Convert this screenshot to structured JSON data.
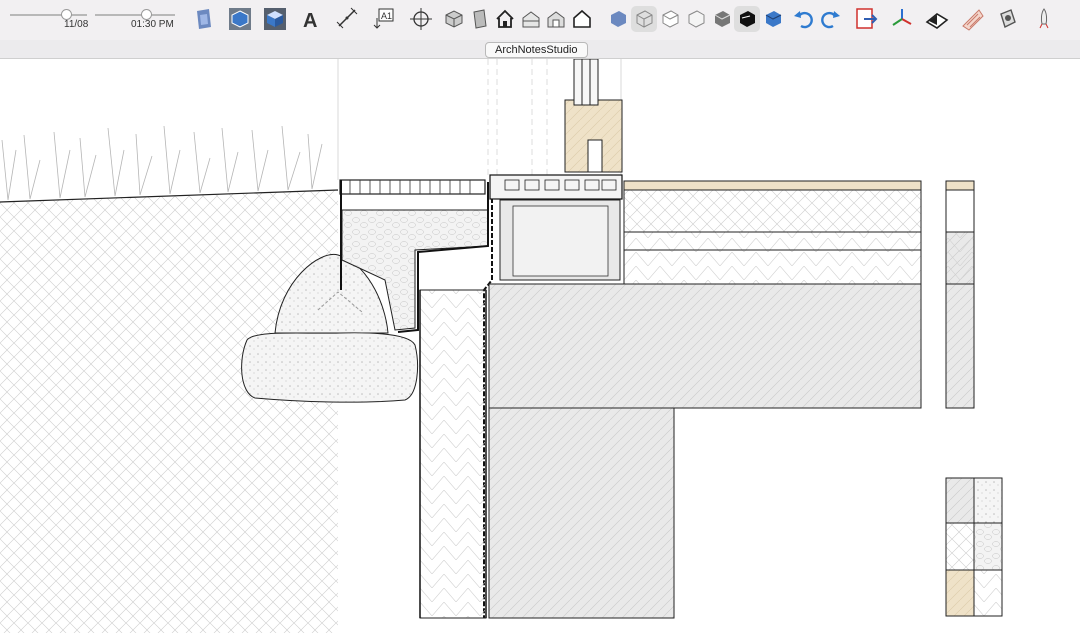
{
  "app": {
    "window_title": "ArchNotesStudio"
  },
  "toolbar": {
    "date_label": "11/08",
    "time_label": "01:30 PM",
    "date_slider_value": 0.72,
    "time_slider_value": 0.62,
    "tools": [
      {
        "name": "section-plane-tool",
        "icon": "section-plane-icon",
        "color": "#4a6fb3"
      },
      {
        "name": "iso-view-tool",
        "icon": "iso-cube-icon",
        "color": "#3b78c8"
      },
      {
        "name": "top-view-tool",
        "icon": "cube-top-icon",
        "color": "#3b78c8"
      },
      {
        "name": "text-3d-tool",
        "icon": "3d-text-icon",
        "color": "#333333"
      },
      {
        "name": "dimension-tool",
        "icon": "dimension-icon",
        "color": "#333333"
      },
      {
        "name": "text-tag-tool",
        "icon": "text-tag-icon",
        "color": "#333333"
      },
      {
        "name": "orbit-tool",
        "icon": "orbit-icon",
        "color": "#333333"
      },
      {
        "name": "component-tool",
        "icon": "component-icon",
        "color": "#555555"
      },
      {
        "name": "group-tool",
        "icon": "group-icon",
        "color": "#555555"
      },
      {
        "name": "home-tool",
        "icon": "home-icon",
        "color": "#222222"
      },
      {
        "name": "house-section-tool",
        "icon": "house-section-icon",
        "color": "#555555"
      },
      {
        "name": "house-open-tool",
        "icon": "house-open-icon",
        "color": "#555555"
      },
      {
        "name": "house-outline-tool",
        "icon": "house-outline-icon",
        "color": "#222222"
      },
      {
        "name": "style-xray-tool",
        "icon": "xray-style-icon",
        "color": "#4a6fb3"
      },
      {
        "name": "style-wireframe-tool",
        "icon": "wireframe-style-icon",
        "color": "#888888"
      },
      {
        "name": "style-hidden-line-tool",
        "icon": "hidden-line-style-icon",
        "color": "#888888"
      },
      {
        "name": "style-shaded-tool",
        "icon": "shaded-style-icon",
        "color": "#888888"
      },
      {
        "name": "style-textured-tool",
        "icon": "textured-style-icon",
        "color": "#777777"
      },
      {
        "name": "style-monochrome-tool",
        "icon": "monochrome-style-icon",
        "color": "#111111"
      },
      {
        "name": "style-color-tool",
        "icon": "color-style-icon",
        "color": "#3b78c8"
      },
      {
        "name": "undo-tool",
        "icon": "undo-icon",
        "color": "#2f7bd0"
      },
      {
        "name": "redo-tool",
        "icon": "redo-icon",
        "color": "#2f7bd0"
      },
      {
        "name": "export-tool",
        "icon": "export-icon",
        "color": "#d0312d"
      },
      {
        "name": "axes-tool",
        "icon": "axes-icon",
        "color": "#2a9a3a"
      },
      {
        "name": "layout-tool",
        "icon": "layout-icon",
        "color": "#222222"
      },
      {
        "name": "material-tool",
        "icon": "material-icon",
        "color": "#c97a6a"
      },
      {
        "name": "paint-tool",
        "icon": "paint-bucket-icon",
        "color": "#555555"
      },
      {
        "name": "rocket-tool",
        "icon": "rocket-icon",
        "color": "#666666"
      }
    ]
  }
}
